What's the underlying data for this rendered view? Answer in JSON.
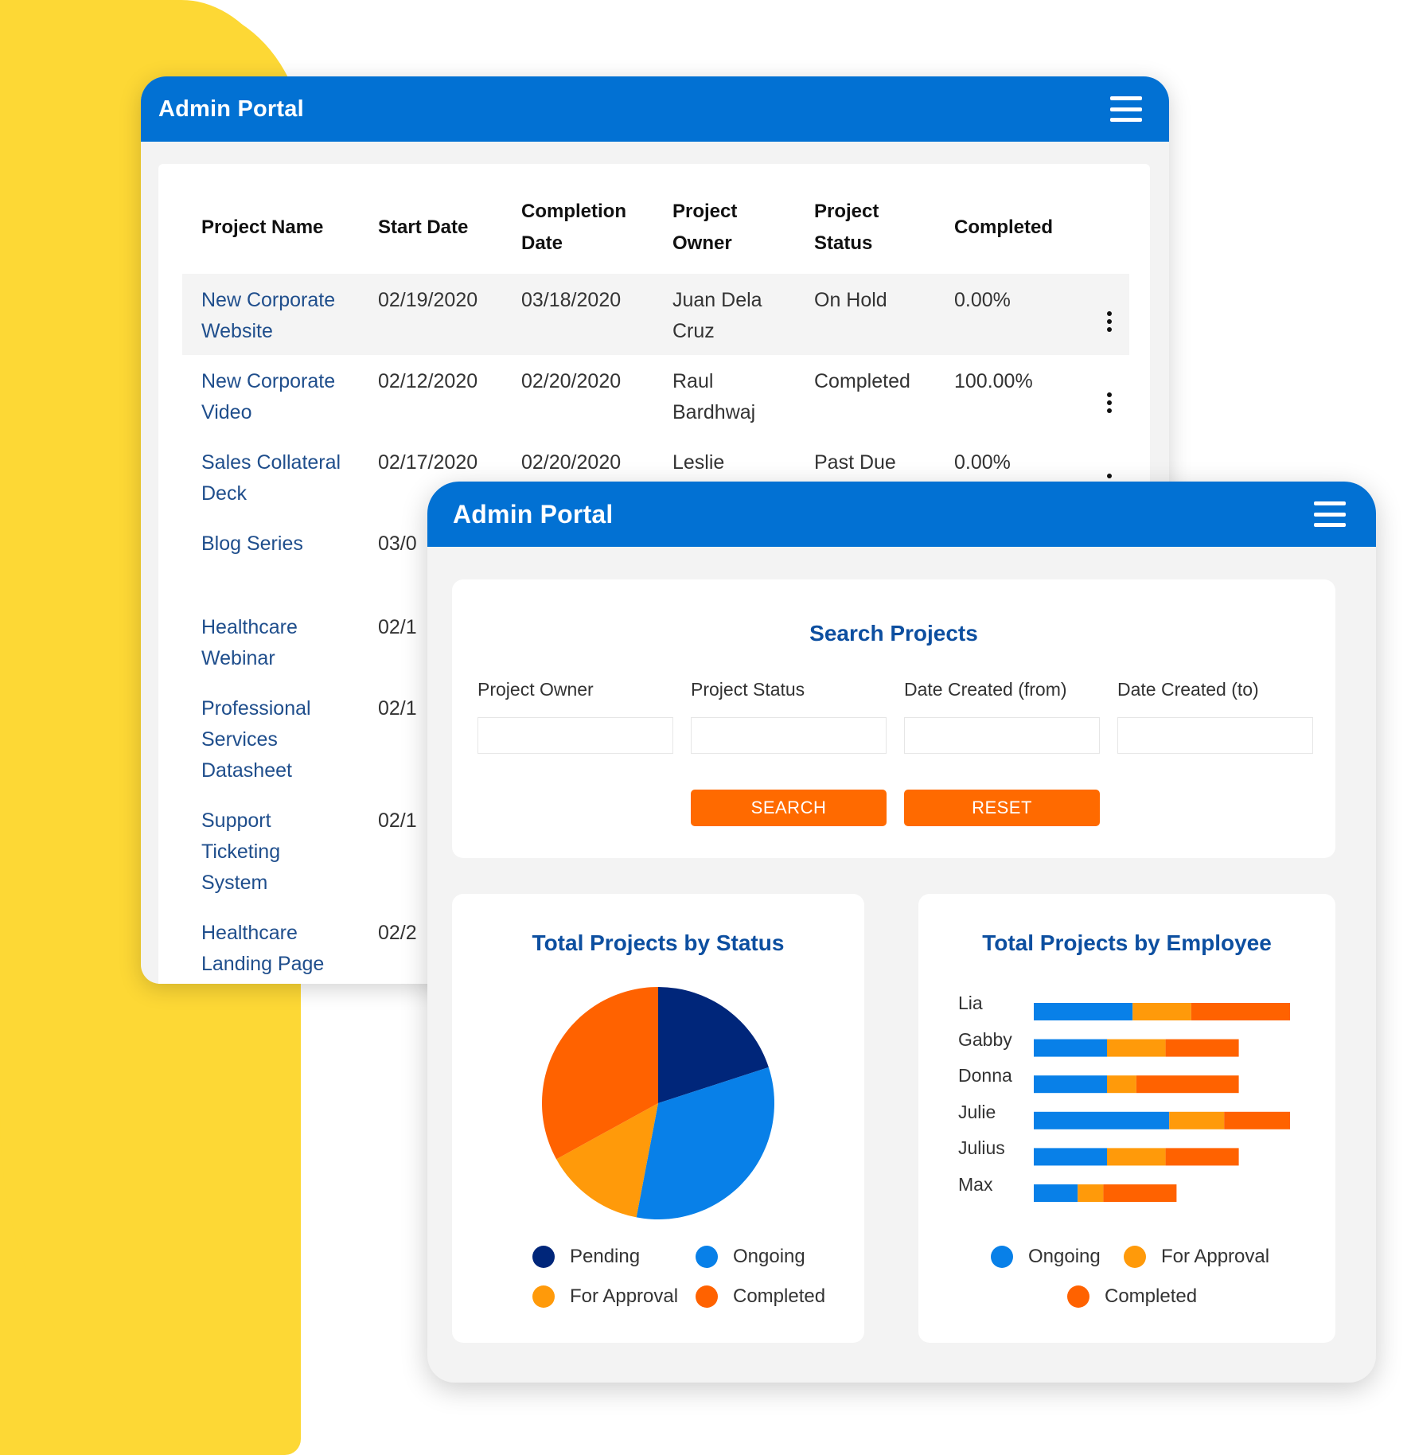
{
  "colors": {
    "brand_blue": "#0271D3",
    "title_blue": "#0D4FA0",
    "accent_orange": "#FF6A00",
    "yellow": "#FDD835"
  },
  "back_window": {
    "title": "Admin Portal",
    "menu_icon": "hamburger-menu-icon",
    "columns": [
      [
        "Project Name"
      ],
      [
        "Start Date"
      ],
      [
        "Completion",
        "Date"
      ],
      [
        "Project",
        "Owner"
      ],
      [
        "Project",
        "Status"
      ],
      [
        "Completed"
      ]
    ],
    "rows": [
      {
        "name": [
          "New Corporate",
          "Website"
        ],
        "start": "02/19/2020",
        "completion": "03/18/2020",
        "owner": [
          "Juan Dela",
          "Cruz"
        ],
        "status": "On Hold",
        "completed": "0.00%"
      },
      {
        "name": [
          "New Corporate",
          "Video"
        ],
        "start": "02/12/2020",
        "completion": "02/20/2020",
        "owner": [
          "Raul",
          "Bardhwaj"
        ],
        "status": "Completed",
        "completed": "100.00%"
      },
      {
        "name": [
          "Sales Collateral",
          "Deck"
        ],
        "start": "02/17/2020",
        "completion": "02/20/2020",
        "owner": [
          "Leslie",
          ""
        ],
        "status": "Past Due",
        "completed": "0.00%"
      },
      {
        "name": [
          "Blog Series"
        ],
        "start": "03/0",
        "completion": "",
        "owner": [
          ""
        ],
        "status": "",
        "completed": ""
      },
      {
        "name": [
          "Healthcare",
          "Webinar"
        ],
        "start": "02/1",
        "completion": "",
        "owner": [
          ""
        ],
        "status": "",
        "completed": ""
      },
      {
        "name": [
          "Professional",
          "Services",
          "Datasheet"
        ],
        "start": "02/1",
        "completion": "",
        "owner": [
          ""
        ],
        "status": "",
        "completed": ""
      },
      {
        "name": [
          "Support",
          "Ticketing",
          "System"
        ],
        "start": "02/1",
        "completion": "",
        "owner": [
          ""
        ],
        "status": "",
        "completed": ""
      },
      {
        "name": [
          "Healthcare",
          "Landing Page"
        ],
        "start": "02/2",
        "completion": "",
        "owner": [
          ""
        ],
        "status": "",
        "completed": ""
      }
    ]
  },
  "front_window": {
    "title": "Admin Portal",
    "menu_icon": "hamburger-menu-icon",
    "search": {
      "title": "Search Projects",
      "fields": [
        {
          "label": "Project Owner",
          "value": ""
        },
        {
          "label": "Project Status",
          "value": ""
        },
        {
          "label": "Date Created (from)",
          "value": ""
        },
        {
          "label": "Date Created (to)",
          "value": ""
        }
      ],
      "search_label": "SEARCH",
      "reset_label": "RESET"
    }
  },
  "chart_data": [
    {
      "type": "pie",
      "title": "Total Projects by Status",
      "slices": [
        {
          "label": "Pending",
          "value": 20,
          "color": "#00267A"
        },
        {
          "label": "Ongoing",
          "value": 33,
          "color": "#0880E8"
        },
        {
          "label": "For Approval",
          "value": 14,
          "color": "#FF9A0A"
        },
        {
          "label": "Completed",
          "value": 33,
          "color": "#FF6200"
        }
      ],
      "legend": "bottom"
    },
    {
      "type": "bar",
      "orientation": "horizontal",
      "stacked": true,
      "title": "Total Projects by Employee",
      "categories": [
        "Lia",
        "Gabby",
        "Donna",
        "Julie",
        "Julius",
        "Max"
      ],
      "series": [
        {
          "name": "Ongoing",
          "color": "#0880E8",
          "values": [
            27,
            20,
            20,
            37,
            20,
            12
          ]
        },
        {
          "name": "For Approval",
          "color": "#FF9A0A",
          "values": [
            16,
            16,
            8,
            15,
            16,
            7
          ]
        },
        {
          "name": "Completed",
          "color": "#FF6200",
          "values": [
            27,
            20,
            28,
            18,
            20,
            20
          ]
        }
      ],
      "legend": "bottom"
    }
  ]
}
